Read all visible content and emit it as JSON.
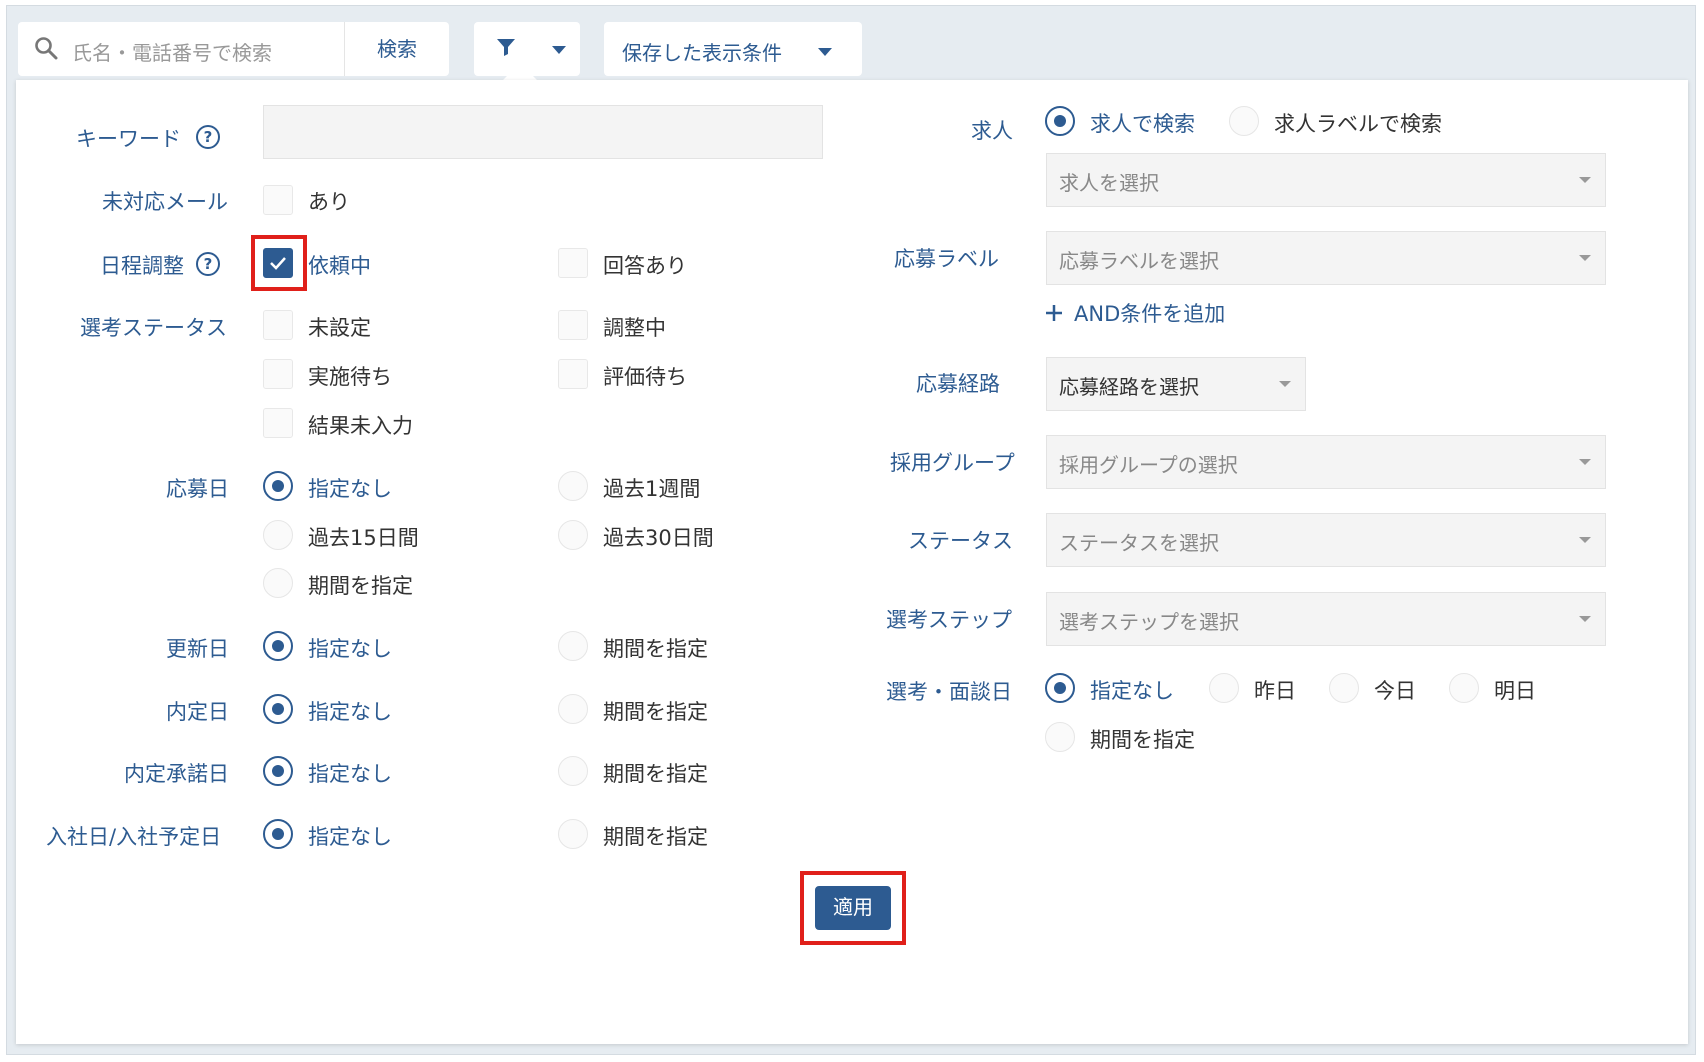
{
  "toolbar": {
    "search_placeholder": "氏名・電話番号で検索",
    "search_button": "検索",
    "saved_conditions": "保存した表示条件"
  },
  "left": {
    "keyword_label": "キーワード",
    "unhandled_mail_label": "未対応メール",
    "unhandled_mail_option": "あり",
    "schedule_label": "日程調整",
    "schedule_options": [
      "依頼中",
      "回答あり"
    ],
    "selection_status_label": "選考ステータス",
    "selection_status_options": [
      "未設定",
      "調整中",
      "実施待ち",
      "評価待ち",
      "結果未入力"
    ],
    "apply_date_label": "応募日",
    "apply_date_options": [
      "指定なし",
      "過去1週間",
      "過去15日間",
      "過去30日間",
      "期間を指定"
    ],
    "updated_label": "更新日",
    "offer_label": "内定日",
    "offer_accept_label": "内定承諾日",
    "join_label": "入社日/入社予定日",
    "none_option": "指定なし",
    "period_option": "期間を指定"
  },
  "right": {
    "job_label": "求人",
    "job_options": [
      "求人で検索",
      "求人ラベルで検索"
    ],
    "job_select": "求人を選択",
    "apply_label_label": "応募ラベル",
    "apply_label_select": "応募ラベルを選択",
    "add_and": "AND条件を追加",
    "route_label": "応募経路",
    "route_select": "応募経路を選択",
    "group_label": "採用グループ",
    "group_select": "採用グループの選択",
    "status_label": "ステータス",
    "status_select": "ステータスを選択",
    "step_label": "選考ステップ",
    "step_select": "選考ステップを選択",
    "interview_label": "選考・面談日",
    "interview_options": [
      "指定なし",
      "昨日",
      "今日",
      "明日",
      "期間を指定"
    ]
  },
  "apply_button": "適用",
  "colors": {
    "accent": "#2d5b91",
    "highlight": "#e0201a"
  },
  "icons": [
    "search-icon",
    "filter-icon",
    "help-icon",
    "check-icon",
    "plus-icon"
  ]
}
